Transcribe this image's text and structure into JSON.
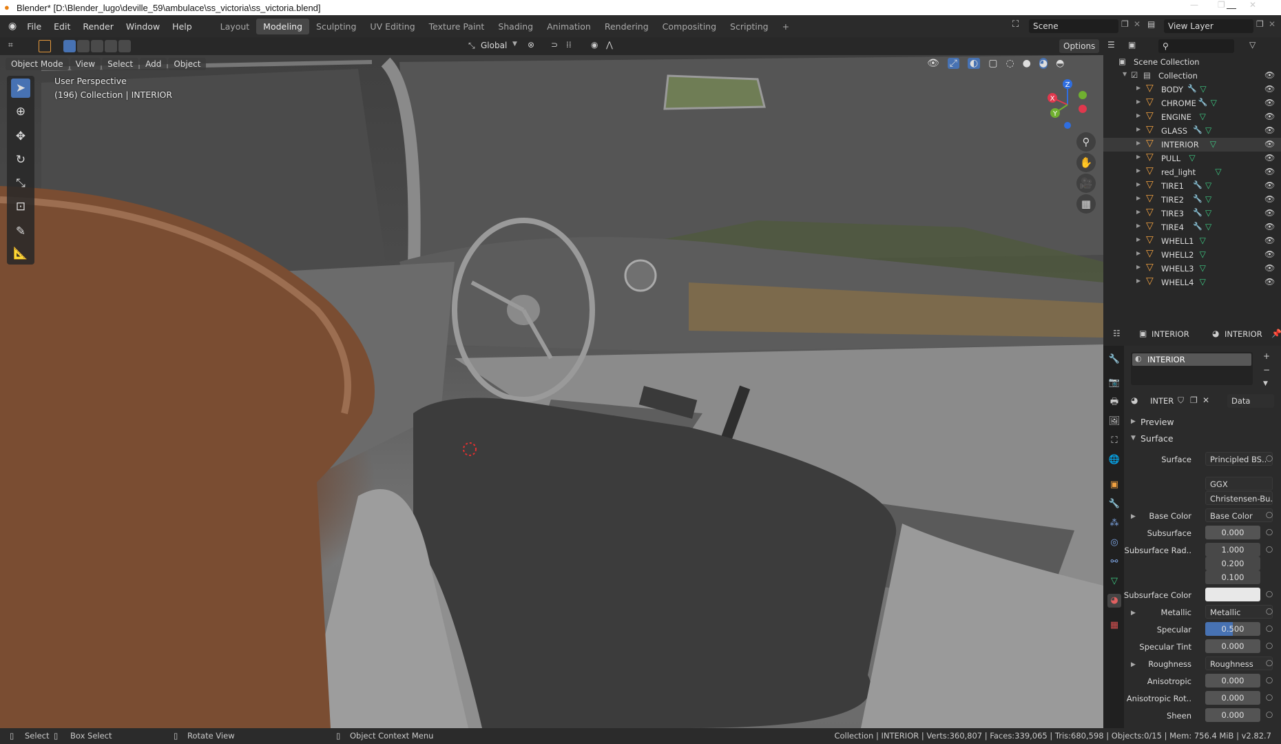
{
  "window": {
    "title": "Blender* [D:\\Blender_lugo\\deville_59\\ambulace\\ss_victoria\\ss_victoria.blend]",
    "minimize": "—",
    "maximize": "❐",
    "close": "✕"
  },
  "menu": [
    "File",
    "Edit",
    "Render",
    "Window",
    "Help"
  ],
  "workspaces": [
    "Layout",
    "Modeling",
    "Sculpting",
    "UV Editing",
    "Texture Paint",
    "Shading",
    "Animation",
    "Rendering",
    "Compositing",
    "Scripting"
  ],
  "active_workspace": "Modeling",
  "scene": {
    "name": "Scene",
    "view_layer": "View Layer"
  },
  "header": {
    "transform_orientation": "Global",
    "options": "Options"
  },
  "viewport": {
    "mode": "Object Mode",
    "menus": [
      "View",
      "Select",
      "Add",
      "Object"
    ],
    "overlay_title": "User Perspective",
    "overlay_subtitle": "(196) Collection | INTERIOR",
    "gizmo": {
      "x": "X",
      "y": "Y",
      "z": "Z"
    }
  },
  "outliner": {
    "root": "Scene Collection",
    "collection": "Collection",
    "items": [
      {
        "name": "BODY",
        "modifier": true
      },
      {
        "name": "CHROME",
        "modifier": true
      },
      {
        "name": "ENGINE",
        "modifier": false
      },
      {
        "name": "GLASS",
        "modifier": true
      },
      {
        "name": "INTERIOR",
        "modifier": false
      },
      {
        "name": "PULL",
        "modifier": false
      },
      {
        "name": "red_light",
        "modifier": false
      },
      {
        "name": "TIRE1",
        "modifier": true
      },
      {
        "name": "TIRE2",
        "modifier": true
      },
      {
        "name": "TIRE3",
        "modifier": true
      },
      {
        "name": "TIRE4",
        "modifier": true
      },
      {
        "name": "WHELL1",
        "modifier": false
      },
      {
        "name": "WHELL2",
        "modifier": false
      },
      {
        "name": "WHELL3",
        "modifier": false
      },
      {
        "name": "WHELL4",
        "modifier": false
      }
    ]
  },
  "properties": {
    "object": "INTERIOR",
    "material": "INTERIOR",
    "slot": "INTERIOR",
    "mat_field": "INTER",
    "link": "Data",
    "preview": "Preview",
    "surface_section": "Surface",
    "rows": {
      "surface": {
        "label": "Surface",
        "value": "Principled BS.."
      },
      "distribution": "GGX",
      "subsurface_method": "Christensen-Bu..",
      "base_color": {
        "label": "Base Color",
        "value": "Base Color"
      },
      "subsurface": {
        "label": "Subsurface",
        "value": "0.000"
      },
      "subsurface_radius": {
        "label": "Subsurface Rad..",
        "values": [
          "1.000",
          "0.200",
          "0.100"
        ]
      },
      "subsurface_color": {
        "label": "Subsurface Color"
      },
      "metallic": {
        "label": "Metallic",
        "value": "Metallic"
      },
      "specular": {
        "label": "Specular",
        "value": "0.500",
        "fraction": 0.5
      },
      "specular_tint": {
        "label": "Specular Tint",
        "value": "0.000"
      },
      "roughness": {
        "label": "Roughness",
        "value": "Roughness"
      },
      "anisotropic": {
        "label": "Anisotropic",
        "value": "0.000"
      },
      "anisotropic_rot": {
        "label": "Anisotropic Rot..",
        "value": "0.000"
      },
      "sheen": {
        "label": "Sheen",
        "value": "0.000"
      }
    }
  },
  "status": {
    "select": "Select",
    "box_select": "Box Select",
    "rotate": "Rotate View",
    "context": "Object Context Menu",
    "stats": "Collection | INTERIOR | Verts:360,807 | Faces:339,065 | Tris:680,598 | Objects:0/15 | Mem: 756.4 MiB | v2.82.7"
  },
  "colors": {
    "accent": "#4772b3",
    "object_orange": "#f0a040",
    "mesh_green": "#3ecb84"
  }
}
